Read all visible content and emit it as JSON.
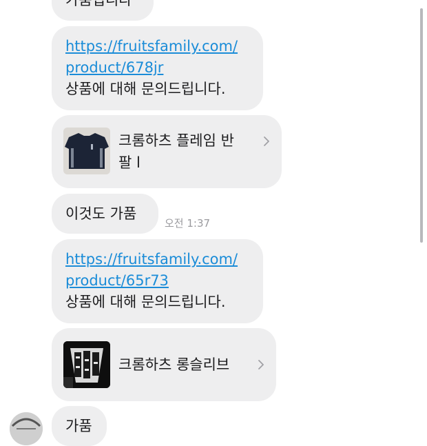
{
  "messages": {
    "top_partial": "가품입니다",
    "link1": {
      "url_line1": "https://fruitsfamily.com/",
      "url_line2": "product/678jr",
      "caption": "상품에 대해 문의드립니다."
    },
    "card1": {
      "title_line1": "크롬하츠 플레임 반",
      "title_line2": "팔 l",
      "thumb_icon": "black-tshirt-thumbnail"
    },
    "text2": {
      "text": "이것도 가품",
      "timestamp": "오전 1:37"
    },
    "link2": {
      "url_line1": "https://fruitsfamily.com/",
      "url_line2": "product/65r73",
      "caption": "상품에 대해 문의드립니다."
    },
    "card2": {
      "title": "크롬하츠 롱슬리브",
      "thumb_icon": "longsleeve-print-thumbnail"
    },
    "bottom_partial": "가품"
  },
  "icons": {
    "chevron": "chevron-right-icon",
    "avatar": "user-avatar"
  },
  "colors": {
    "bubble": "#eeeeef",
    "link": "#1a8cd8",
    "timestamp": "#9a9a9e"
  }
}
